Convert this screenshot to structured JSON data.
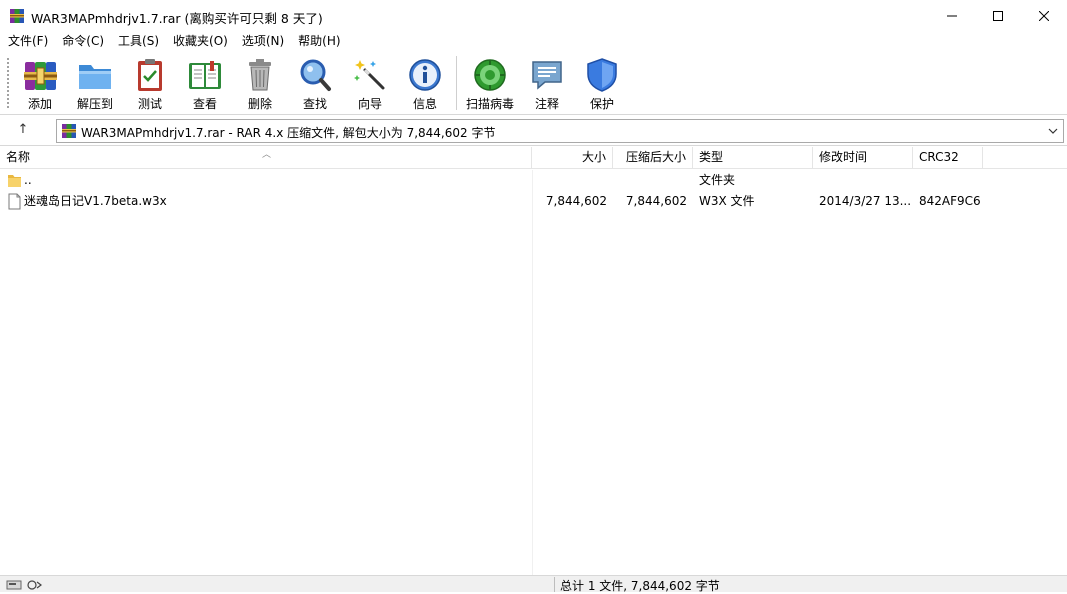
{
  "window": {
    "title": "WAR3MAPmhdrjv1.7.rar (离购买许可只剩 8 天了)"
  },
  "menu": [
    {
      "label": "文件(F)"
    },
    {
      "label": "命令(C)"
    },
    {
      "label": "工具(S)"
    },
    {
      "label": "收藏夹(O)"
    },
    {
      "label": "选项(N)"
    },
    {
      "label": "帮助(H)"
    }
  ],
  "toolbar": [
    {
      "label": "添加",
      "icon": "add-archive-icon"
    },
    {
      "label": "解压到",
      "icon": "extract-folder-icon"
    },
    {
      "label": "测试",
      "icon": "test-clipboard-icon"
    },
    {
      "label": "查看",
      "icon": "view-book-icon"
    },
    {
      "label": "删除",
      "icon": "trash-icon"
    },
    {
      "label": "查找",
      "icon": "magnifier-icon"
    },
    {
      "label": "向导",
      "icon": "wizard-wand-icon"
    },
    {
      "label": "信息",
      "icon": "info-icon"
    },
    {
      "label": "扫描病毒",
      "icon": "virus-scan-icon"
    },
    {
      "label": "注释",
      "icon": "comment-icon"
    },
    {
      "label": "保护",
      "icon": "shield-icon"
    }
  ],
  "address": {
    "text": "WAR3MAPmhdrjv1.7.rar - RAR 4.x 压缩文件, 解包大小为 7,844,602 字节"
  },
  "columns": {
    "name": "名称",
    "size": "大小",
    "packed": "压缩后大小",
    "type": "类型",
    "modified": "修改时间",
    "crc": "CRC32"
  },
  "files": [
    {
      "name": "..",
      "size": "",
      "packed": "",
      "type": "文件夹",
      "modified": "",
      "crc": "",
      "icon": "folder-icon"
    },
    {
      "name": "迷魂岛日记V1.7beta.w3x",
      "size": "7,844,602",
      "packed": "7,844,602",
      "type": "W3X 文件",
      "modified": "2014/3/27 13...",
      "crc": "842AF9C6",
      "icon": "file-icon"
    }
  ],
  "status": {
    "text": "总计 1 文件, 7,844,602 字节"
  },
  "colors": {
    "accent": "#1e73be"
  }
}
